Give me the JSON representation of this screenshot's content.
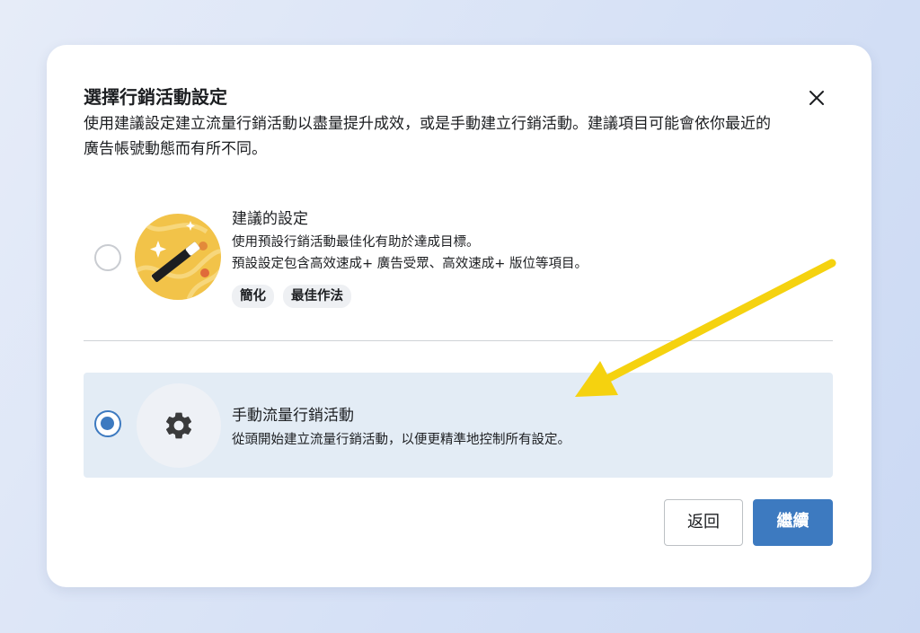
{
  "modal": {
    "title": "選擇行銷活動設定",
    "description": "使用建議設定建立流量行銷活動以盡量提升成效，或是手動建立行銷活動。建議項目可能會依你最近的廣告帳號動態而有所不同。"
  },
  "options": [
    {
      "title": "建議的設定",
      "line1": "使用預設行銷活動最佳化有助於達成目標。",
      "line2": "預設設定包含高效速成+ 廣告受眾、高效速成+ 版位等項目。",
      "tags": [
        "簡化",
        "最佳作法"
      ],
      "icon": "magic-wand-icon",
      "selected": false
    },
    {
      "title": "手動流量行銷活動",
      "line1": "從頭開始建立流量行銷活動，以便更精準地控制所有設定。",
      "icon": "gear-icon",
      "selected": true
    }
  ],
  "buttons": {
    "back": "返回",
    "next": "繼續"
  },
  "colors": {
    "accent": "#3d7ac0",
    "selected_bg": "#e3ecf5",
    "annotation_arrow": "#f5d20f"
  }
}
